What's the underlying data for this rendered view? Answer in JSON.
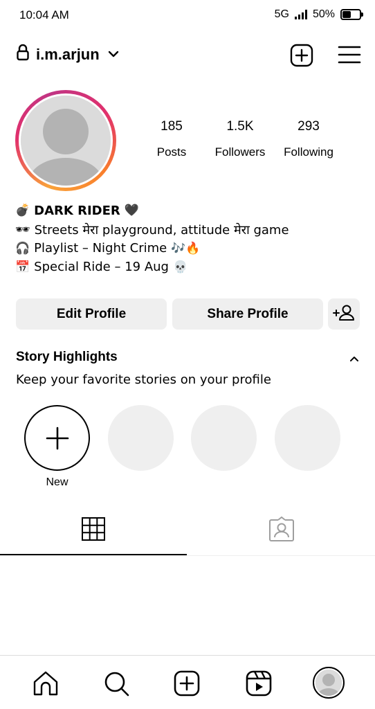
{
  "status_bar": {
    "time": "10:04 AM",
    "network": "5G",
    "battery": "50%",
    "battery_level": 0.5
  },
  "header": {
    "username": "i.m.arjun"
  },
  "profile": {
    "stats": [
      {
        "value": "185",
        "label": "Posts"
      },
      {
        "value": "1.5K",
        "label": "Followers"
      },
      {
        "value": "293",
        "label": "Following"
      }
    ],
    "bio": {
      "name": "DARK RIDER",
      "name_prefix_emoji": "💣",
      "name_suffix_emoji": "🖤",
      "lines": [
        {
          "prefix": "🕶",
          "text": "Streets मेरा playground, attitude मेरा game",
          "suffix": ""
        },
        {
          "prefix": "🎧",
          "text": "Playlist – Night Crime",
          "suffix": "🎶🔥"
        },
        {
          "prefix": "📅",
          "text": "Special Ride – 19 Aug",
          "suffix": "💀"
        }
      ]
    }
  },
  "buttons": {
    "edit_profile": "Edit Profile",
    "share_profile": "Share Profile"
  },
  "highlights": {
    "title": "Story Highlights",
    "subtitle": "Keep your favorite stories on your profile",
    "new_label": "New"
  },
  "icons": {
    "header": [
      "lock-icon",
      "chevron-down-icon",
      "create-icon",
      "menu-icon"
    ],
    "tabs": [
      "grid-icon",
      "tagged-icon"
    ],
    "nav": [
      "home-icon",
      "search-icon",
      "create-icon",
      "reels-icon",
      "profile-avatar"
    ]
  },
  "colors": {
    "button_bg": "#efefef",
    "story_ring_start": "#f9a23a",
    "story_ring_end": "#e1306c"
  }
}
